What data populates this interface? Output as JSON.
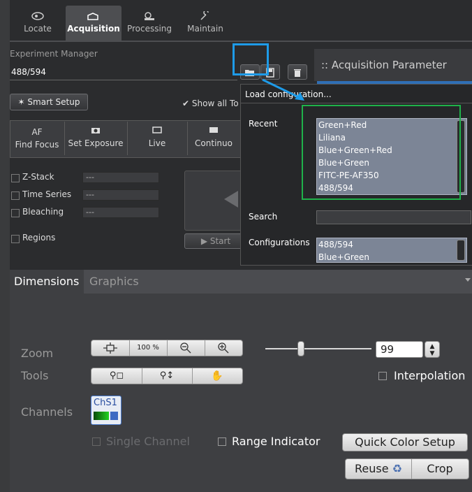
{
  "tabs": [
    {
      "label": "Locate",
      "icon": "locate-icon"
    },
    {
      "label": "Acquisition",
      "icon": "acquisition-icon"
    },
    {
      "label": "Processing",
      "icon": "processing-icon"
    },
    {
      "label": "Maintain",
      "icon": "maintain-icon"
    }
  ],
  "experiment": {
    "title": "Experiment Manager",
    "value": "488/594"
  },
  "acq_param": "Acquisition Parameter",
  "smart_setup": "Smart Setup",
  "show_all": "Show all To",
  "toolbar": [
    {
      "top": "AF",
      "bottom": "Find Focus"
    },
    {
      "top": "",
      "bottom": "Set Exposure"
    },
    {
      "top": "",
      "bottom": "Live"
    },
    {
      "top": "",
      "bottom": "Continuo"
    }
  ],
  "options": [
    {
      "label": "Z-Stack",
      "value": "---"
    },
    {
      "label": "Time Series",
      "value": "---"
    },
    {
      "label": "Bleaching",
      "value": "---"
    },
    {
      "label": "Regions",
      "value": ""
    }
  ],
  "start_label": "Start",
  "popup": {
    "title": "Load configuration...",
    "recent_label": "Recent",
    "recent": [
      "Green+Red",
      "Liliana",
      "Blue+Green+Red",
      "Blue+Green",
      "FITC-PE-AF350",
      "488/594"
    ],
    "search_label": "Search",
    "configs_label": "Configurations",
    "configs": [
      "488/594",
      "Blue+Green"
    ]
  },
  "bottom_tabs": [
    "Dimensions",
    "Graphics"
  ],
  "zoom": {
    "label": "Zoom",
    "preset": "100 %",
    "value": "99",
    "slider_fraction": 0.22
  },
  "tools_label": "Tools",
  "interpolation": "Interpolation",
  "channels": {
    "label": "Channels",
    "chip": "ChS1"
  },
  "single_channel": "Single Channel",
  "range_indicator": "Range Indicator",
  "quick_color": "Quick Color Setup",
  "reuse": "Reuse",
  "crop": "Crop",
  "colors": {
    "highlight_blue": "#1e9be8",
    "highlight_green": "#1fb24a"
  }
}
